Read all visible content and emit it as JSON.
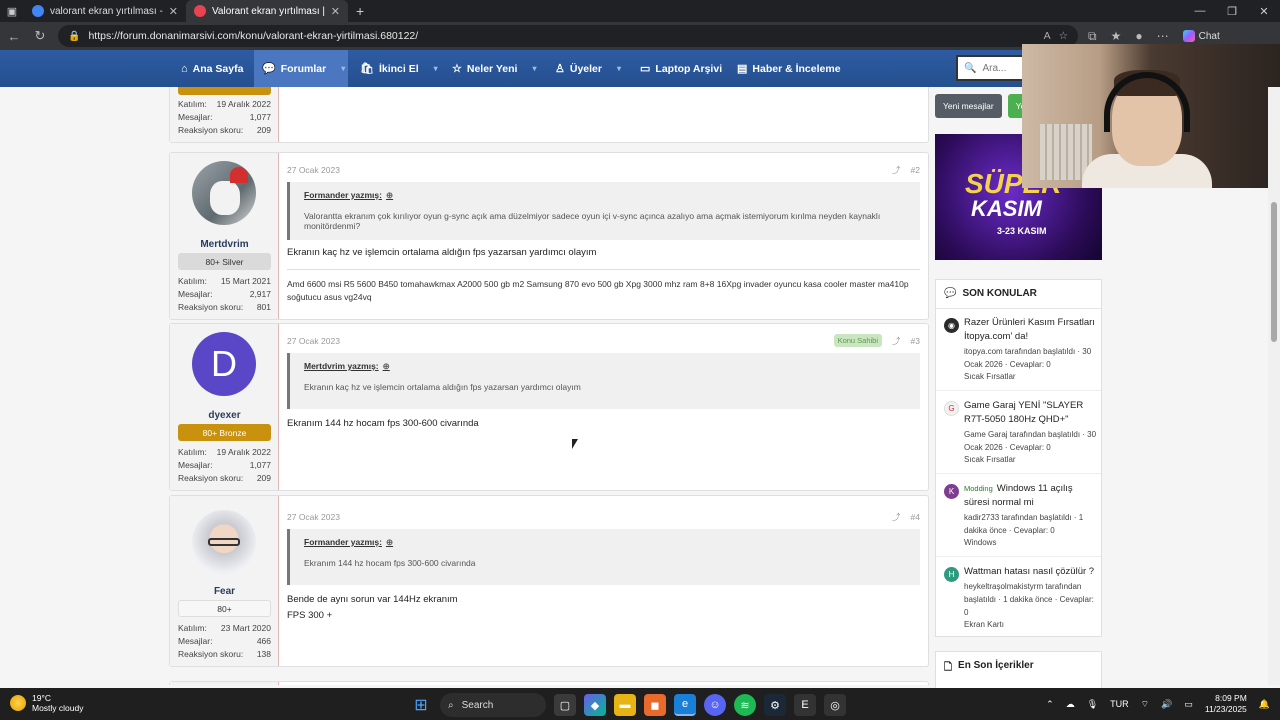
{
  "browser": {
    "tabs": [
      {
        "title": "valorant ekran yırtılması - Google",
        "active": false,
        "color": "#4285f4"
      },
      {
        "title": "Valorant ekran yırtılması | Donanı",
        "active": true,
        "color": "#e8434e"
      }
    ],
    "url": "https://forum.donanimarsivi.com/konu/valorant-ekran-yirtilmasi.680122/",
    "chat_label": "Chat"
  },
  "nav": {
    "items": [
      {
        "label": "Ana Sayfa",
        "icon": "home-icon"
      },
      {
        "label": "Forumlar",
        "icon": "comments-icon"
      },
      {
        "label": "İkinci El",
        "icon": "bag-icon"
      },
      {
        "label": "Neler Yeni",
        "icon": "star-icon"
      },
      {
        "label": "Üyeler",
        "icon": "user-icon"
      },
      {
        "label": "Laptop Arşivi",
        "icon": "laptop-icon"
      },
      {
        "label": "Haber & İnceleme",
        "icon": "news-icon"
      }
    ],
    "search_placeholder": "Ara..."
  },
  "posts": [
    {
      "partial": true,
      "user_stats": [
        {
          "label": "Katılım:",
          "value": "19 Aralık 2022"
        },
        {
          "label": "Mesajlar:",
          "value": "1,077"
        },
        {
          "label": "Reaksiyon skoru:",
          "value": "209"
        }
      ]
    },
    {
      "username": "Mertdvrim",
      "rank": "80+ Silver",
      "user_stats": [
        {
          "label": "Katılım:",
          "value": "15 Mart 2021"
        },
        {
          "label": "Mesajlar:",
          "value": "2,917"
        },
        {
          "label": "Reaksiyon skoru:",
          "value": "801"
        }
      ],
      "date": "27 Ocak 2023",
      "number": "#2",
      "quote_author": "Formander yazmış:",
      "quote_text": "Valorantta ekranım çok kırılıyor oyun g-sync açık ama düzelmiyor sadece oyun içi v-sync açınca azalıyo ama açmak istemiyorum kırılma neyden kaynaklı monitördenmi?",
      "body": [
        "Ekranın kaç hz ve işlemcin ortalama aldığın fps yazarsan yardımcı olayım"
      ],
      "signature": "Amd 6600 msi R5 5600 B450 tomahawkmax A2000 500 gb m2 Samsung 870 evo 500 gb Xpg 3000 mhz ram 8+8 16Xpg invader oyuncu kasa cooler master ma410p soğutucu asus vg24vq"
    },
    {
      "username": "dyexer",
      "avatar_letter": "D",
      "rank": "80+ Bronze",
      "user_stats": [
        {
          "label": "Katılım:",
          "value": "19 Aralık 2022"
        },
        {
          "label": "Mesajlar:",
          "value": "1,077"
        },
        {
          "label": "Reaksiyon skoru:",
          "value": "209"
        }
      ],
      "date": "27 Ocak 2023",
      "owner_badge": "Konu Sahibi",
      "number": "#3",
      "quote_author": "Mertdvrim yazmış:",
      "quote_text": "Ekranın kaç hz ve işlemcin ortalama aldığın fps yazarsan yardımcı olayım",
      "body": [
        "Ekranım 144 hz hocam fps 300-600 civarında"
      ]
    },
    {
      "username": "Fear",
      "rank": "80+",
      "user_stats": [
        {
          "label": "Katılım:",
          "value": "23 Mart 2020"
        },
        {
          "label": "Mesajlar:",
          "value": "466"
        },
        {
          "label": "Reaksiyon skoru:",
          "value": "138"
        }
      ],
      "date": "27 Ocak 2023",
      "number": "#4",
      "quote_author": "Formander yazmış:",
      "quote_text": "Ekranım 144 hz hocam fps 300-600 civarında",
      "body": [
        "Bende de aynı sorun var 144Hz ekranım",
        "FPS 300 +"
      ]
    }
  ],
  "sidebar": {
    "buttons": [
      {
        "label": "Yeni mesajlar",
        "color": "#555c66"
      },
      {
        "label": "Yeni",
        "color": "#4caf50"
      }
    ],
    "banner": {
      "line1": "SÜPER",
      "line2": "KASIM",
      "line3": "3-23 KASIM"
    },
    "recent_title": "SON KONULAR",
    "recent": [
      {
        "avatar_letter": "",
        "avatar_color": "#2b2b2b",
        "tag": "",
        "title": "Razer Ürünleri Kasım Fırsatları İtopya.com' da!",
        "meta": "itopya.com tarafından başlatıldı · 30 Ocak 2026 · Cevaplar: 0",
        "forum": "Sıcak Fırsatlar"
      },
      {
        "avatar_letter": "",
        "avatar_color": "#f2f2f2",
        "tag": "",
        "title": "Game Garaj YENİ \"SLAYER R7T-5050 180Hz QHD+\"",
        "meta": "Game Garaj tarafından başlatıldı · 30 Ocak 2026 · Cevaplar: 0",
        "forum": "Sıcak Fırsatlar"
      },
      {
        "avatar_letter": "K",
        "avatar_color": "#7e3d8f",
        "tag": "Modding",
        "title": "Windows 11 açılış süresi normal mi",
        "meta": "kadir2733 tarafından başlatıldı · 1 dakika önce · Cevaplar: 0",
        "forum": "Windows"
      },
      {
        "avatar_letter": "H",
        "avatar_color": "#2e9b80",
        "tag": "",
        "title": "Wattman hatası nasıl çözülür ?",
        "meta": "heykeltraşolmakistyrm tarafından başlatıldı · 1 dakika önce · Cevaplar: 0",
        "forum": "Ekran Kartı"
      }
    ],
    "latest_title": "En Son İçerikler"
  },
  "taskbar": {
    "weather_temp": "19°C",
    "weather_desc": "Mostly cloudy",
    "search_label": "Search",
    "language": "TUR",
    "time": "8:09 PM",
    "date": "11/23/2025"
  }
}
